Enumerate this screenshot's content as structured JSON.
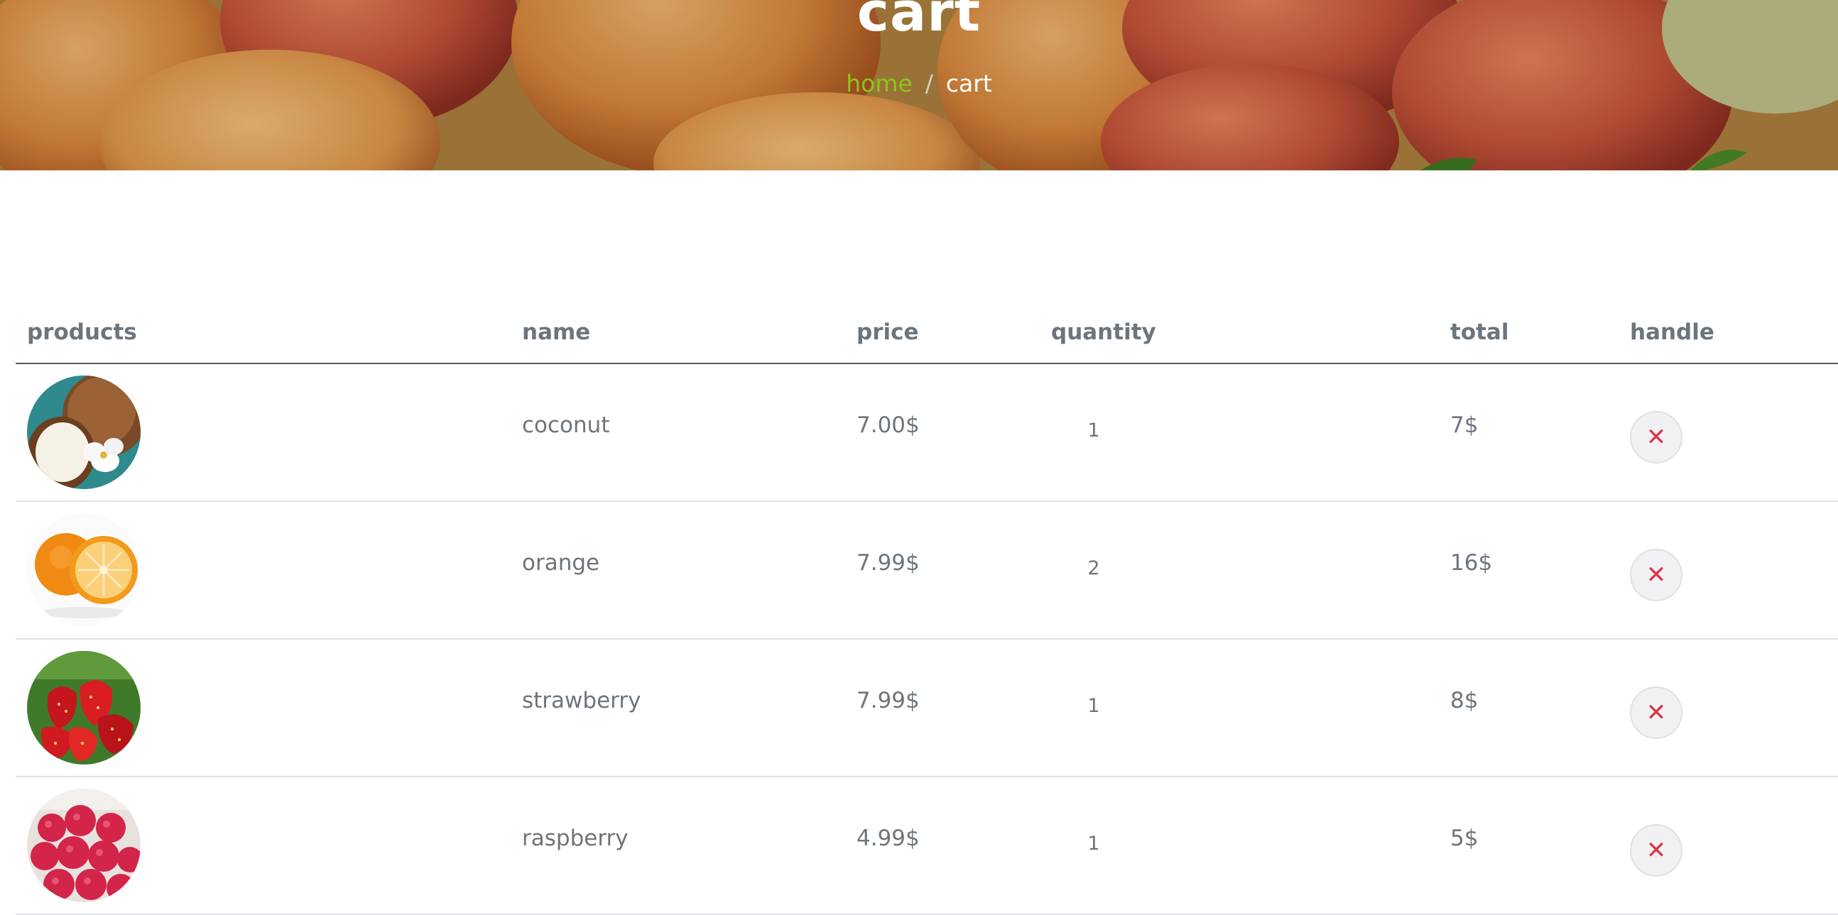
{
  "hero": {
    "title": "cart",
    "breadcrumb": {
      "home": "home",
      "separator": "/",
      "current": "cart"
    }
  },
  "table": {
    "headers": {
      "products": "products",
      "name": "name",
      "price": "price",
      "quantity": "quantity",
      "total": "total",
      "handle": "handle"
    },
    "rows": [
      {
        "image": "coconut-image",
        "name": "coconut",
        "price": "7.00$",
        "quantity": "1",
        "total": "7$"
      },
      {
        "image": "orange-image",
        "name": "orange",
        "price": "7.99$",
        "quantity": "2",
        "total": "16$"
      },
      {
        "image": "strawberry-image",
        "name": "strawberry",
        "price": "7.99$",
        "quantity": "1",
        "total": "8$"
      },
      {
        "image": "raspberry-image",
        "name": "raspberry",
        "price": "4.99$",
        "quantity": "1",
        "total": "5$"
      }
    ],
    "remove_icon": "close-icon"
  },
  "colors": {
    "accent_green": "#8dc31f",
    "remove_red": "#dc3545",
    "text_muted": "#6c757d"
  }
}
